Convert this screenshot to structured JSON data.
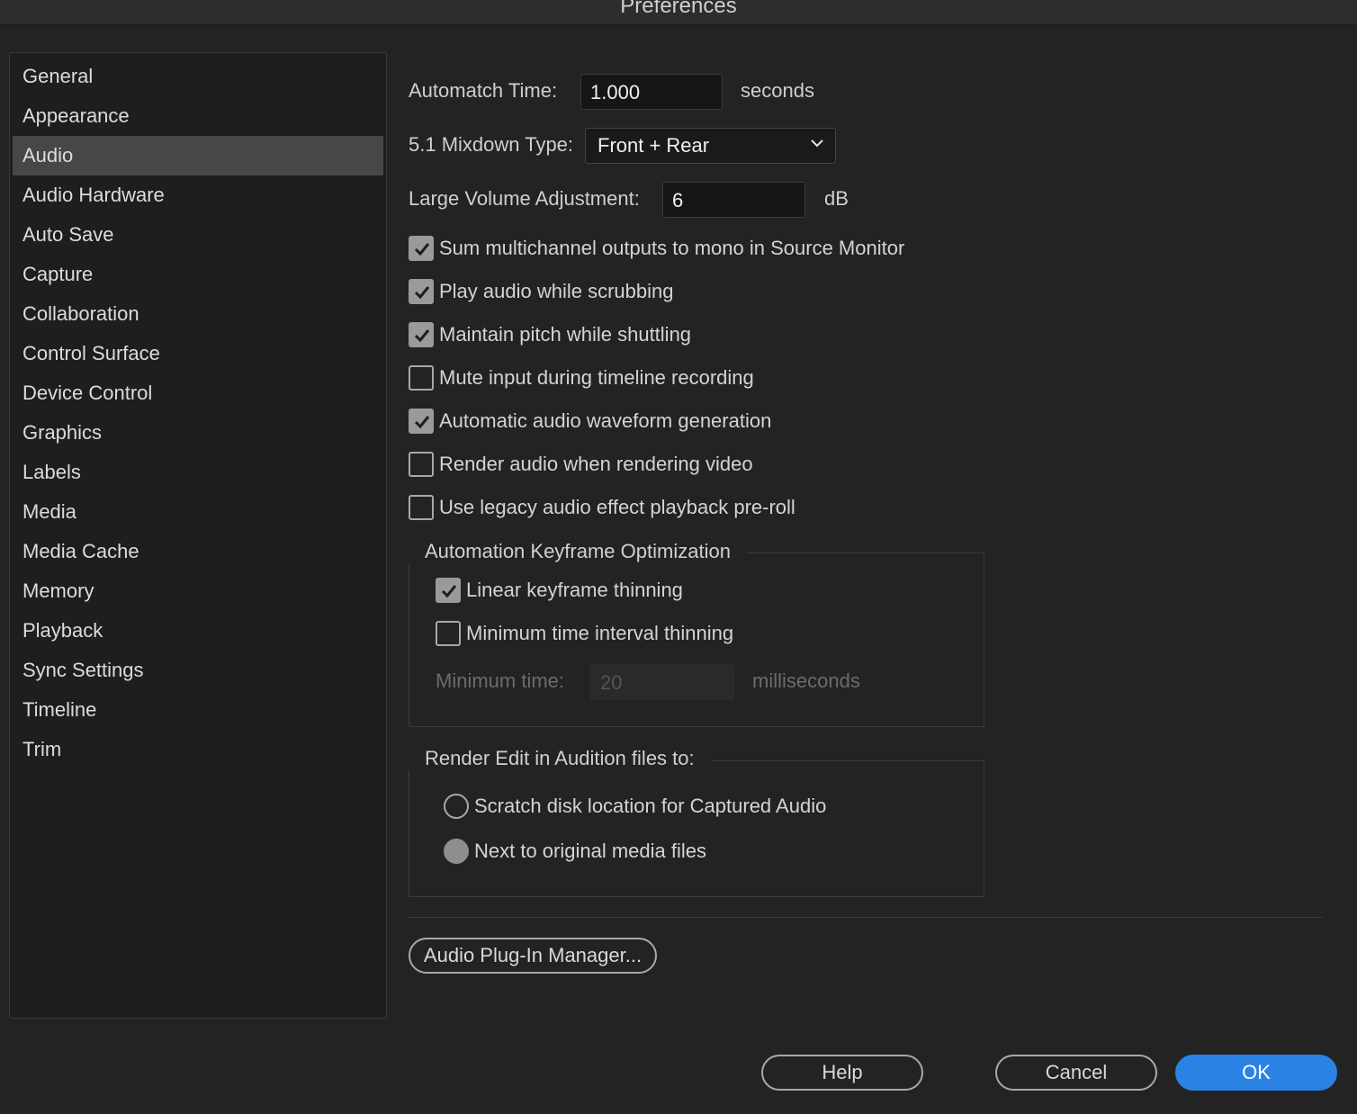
{
  "window": {
    "title": "Preferences"
  },
  "sidebar": {
    "items": [
      {
        "label": "General"
      },
      {
        "label": "Appearance"
      },
      {
        "label": "Audio"
      },
      {
        "label": "Audio Hardware"
      },
      {
        "label": "Auto Save"
      },
      {
        "label": "Capture"
      },
      {
        "label": "Collaboration"
      },
      {
        "label": "Control Surface"
      },
      {
        "label": "Device Control"
      },
      {
        "label": "Graphics"
      },
      {
        "label": "Labels"
      },
      {
        "label": "Media"
      },
      {
        "label": "Media Cache"
      },
      {
        "label": "Memory"
      },
      {
        "label": "Playback"
      },
      {
        "label": "Sync Settings"
      },
      {
        "label": "Timeline"
      },
      {
        "label": "Trim"
      }
    ],
    "selected": "Audio"
  },
  "audio": {
    "automatch": {
      "label": "Automatch Time:",
      "value": "1.000",
      "unit": "seconds"
    },
    "mixdown": {
      "label": "5.1 Mixdown Type:",
      "value": "Front + Rear"
    },
    "large_volume": {
      "label": "Large Volume Adjustment:",
      "value": "6",
      "unit": "dB"
    },
    "options": [
      {
        "label": "Sum multichannel outputs to mono in Source Monitor",
        "checked": true
      },
      {
        "label": "Play audio while scrubbing",
        "checked": true
      },
      {
        "label": "Maintain pitch while shuttling",
        "checked": true
      },
      {
        "label": "Mute input during timeline recording",
        "checked": false
      },
      {
        "label": "Automatic audio waveform generation",
        "checked": true
      },
      {
        "label": "Render audio when rendering video",
        "checked": false
      },
      {
        "label": "Use legacy audio effect playback pre-roll",
        "checked": false
      }
    ],
    "keyframe_group": {
      "title": "Automation Keyframe Optimization",
      "linear": {
        "label": "Linear keyframe thinning",
        "checked": true
      },
      "min_interval": {
        "label": "Minimum time interval thinning",
        "checked": false
      },
      "min_time": {
        "label": "Minimum time:",
        "placeholder": "20",
        "unit": "milliseconds"
      }
    },
    "render_group": {
      "title": "Render Edit in Audition files to:",
      "options": [
        {
          "label": "Scratch disk location for Captured Audio",
          "selected": false
        },
        {
          "label": "Next to original media files",
          "selected": true
        }
      ]
    },
    "plugin_button": "Audio Plug-In Manager..."
  },
  "footer": {
    "help": "Help",
    "cancel": "Cancel",
    "ok": "OK"
  },
  "colors": {
    "accent": "#2a82e4",
    "selected_item": "#474747",
    "background": "#232323"
  }
}
